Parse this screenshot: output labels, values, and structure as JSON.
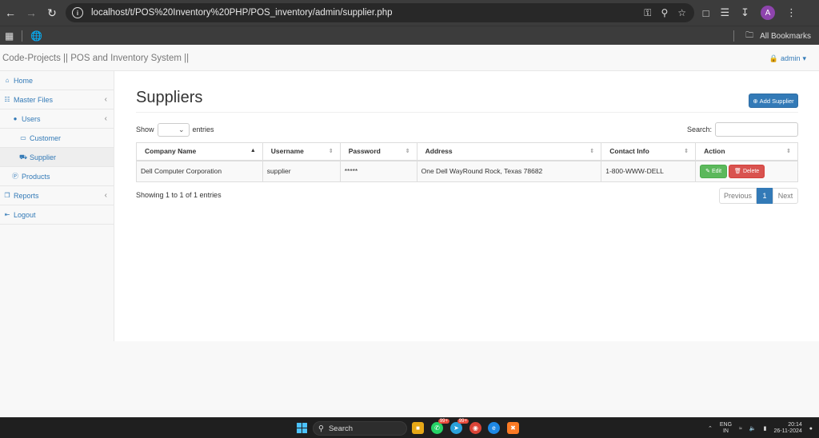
{
  "browser": {
    "url": "localhost/t/POS%20Inventory%20PHP/POS_inventory/admin/supplier.php",
    "profile_initial": "A",
    "bookmarks_label": "All Bookmarks"
  },
  "header": {
    "brand": "Code-Projects || POS and Inventory System ||",
    "user": "admin"
  },
  "sidebar": {
    "items": [
      {
        "label": "Home"
      },
      {
        "label": "Master Files"
      },
      {
        "label": "Users"
      },
      {
        "label": "Customer"
      },
      {
        "label": "Supplier"
      },
      {
        "label": "Products"
      },
      {
        "label": "Reports"
      },
      {
        "label": "Logout"
      }
    ]
  },
  "main": {
    "title": "Suppliers",
    "add_button": "Add Supplier",
    "show_label": "Show",
    "entries_label": "entries",
    "search_label": "Search:",
    "columns": [
      "Company Name",
      "Username",
      "Password",
      "Address",
      "Contact Info",
      "Action"
    ],
    "rows": [
      {
        "company": "Dell Computer Corporation",
        "username": "supplier",
        "password": "*****",
        "address": "One Dell WayRound Rock, Texas 78682",
        "contact": "1-800-WWW-DELL"
      }
    ],
    "edit_label": "Edit",
    "delete_label": "Delete",
    "info": "Showing 1 to 1 of 1 entries",
    "pager": {
      "prev": "Previous",
      "current": "1",
      "next": "Next"
    }
  },
  "taskbar": {
    "search": "Search",
    "badge1": "99+",
    "badge2": "99+",
    "lang_top": "ENG",
    "lang_bottom": "IN",
    "time": "20:14",
    "date": "26-11-2024"
  },
  "colors": {
    "primary": "#337ab7",
    "success": "#5cb85c",
    "danger": "#d9534f",
    "chrome": "#3c3c3c"
  }
}
